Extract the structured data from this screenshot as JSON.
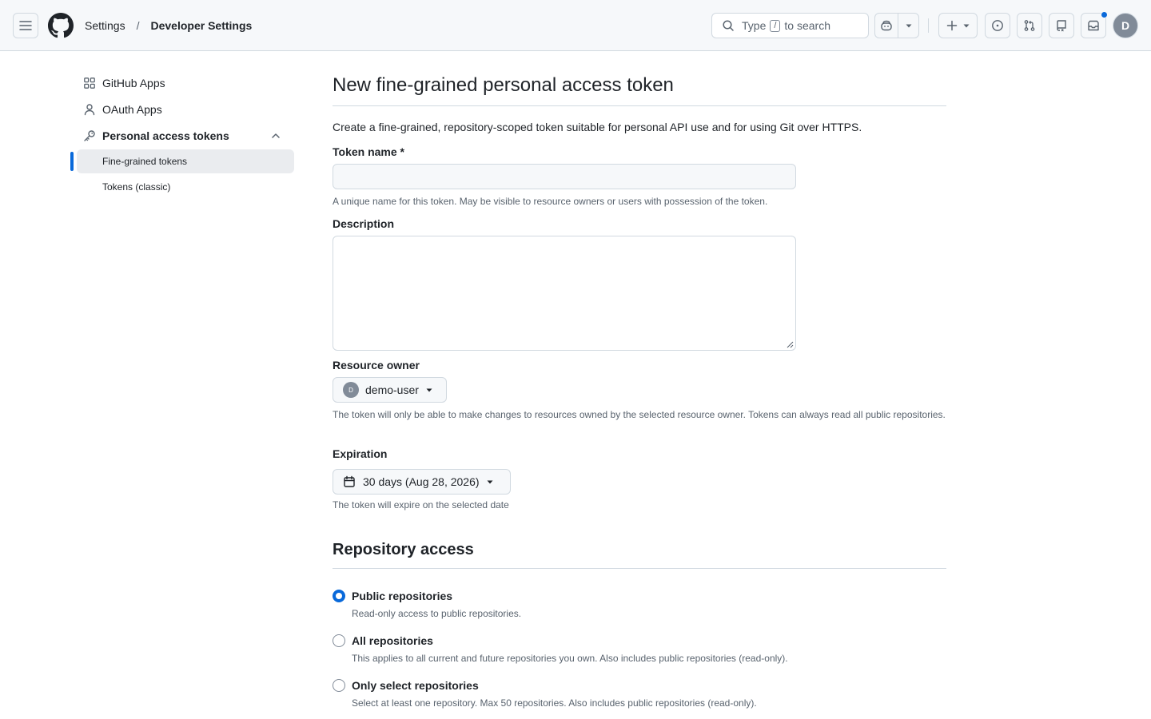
{
  "header": {
    "breadcrumb_parent": "Settings",
    "breadcrumb_separator": "/",
    "breadcrumb_current": "Developer Settings",
    "search_prefix": "Type",
    "search_key": "/",
    "search_suffix": "to search",
    "avatar_initial": "D",
    "has_notification": true,
    "accent_color": "#0969da"
  },
  "sidebar": {
    "items": [
      {
        "label": "GitHub Apps",
        "icon": "apps-icon"
      },
      {
        "label": "OAuth Apps",
        "icon": "person-icon"
      },
      {
        "label": "Personal access tokens",
        "icon": "key-icon",
        "expanded": true
      }
    ],
    "subitems": [
      {
        "label": "Fine-grained tokens",
        "active": true
      },
      {
        "label": "Tokens (classic)",
        "active": false
      }
    ]
  },
  "main": {
    "title": "New fine-grained personal access token",
    "intro": "Create a fine-grained, repository-scoped token suitable for personal API use and for using Git over HTTPS.",
    "token_name": {
      "label": "Token name *",
      "value": "",
      "help": "A unique name for this token. May be visible to resource owners or users with possession of the token."
    },
    "description": {
      "label": "Description",
      "value": ""
    },
    "resource_owner": {
      "label": "Resource owner",
      "avatar_initial": "D",
      "value": "demo-user",
      "help": "The token will only be able to make changes to resources owned by the selected resource owner. Tokens can always read all public repositories."
    },
    "expiration": {
      "label": "Expiration",
      "value": "30 days (Aug 28, 2026)",
      "help": "The token will expire on the selected date"
    },
    "repository_access": {
      "title": "Repository access",
      "options": [
        {
          "label": "Public repositories",
          "help": "Read-only access to public repositories.",
          "selected": true
        },
        {
          "label": "All repositories",
          "help": "This applies to all current and future repositories you own. Also includes public repositories (read-only).",
          "selected": false
        },
        {
          "label": "Only select repositories",
          "help": "Select at least one repository. Max 50 repositories. Also includes public repositories (read-only).",
          "selected": false
        }
      ]
    }
  }
}
